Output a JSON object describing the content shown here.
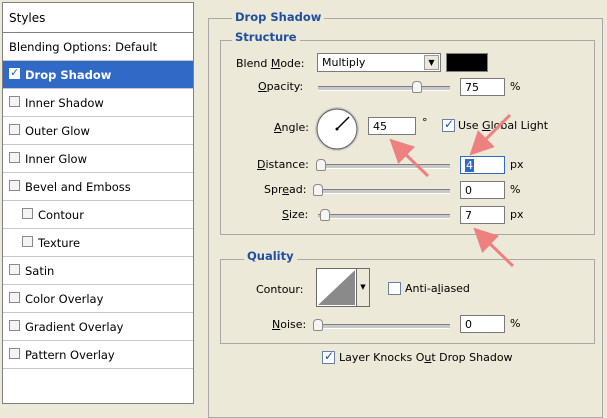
{
  "sidebar": {
    "header": "Styles",
    "items": [
      {
        "label": "Blending Options: Default",
        "checkbox": false,
        "checked": false,
        "selected": false,
        "indent": false
      },
      {
        "label": "Drop Shadow",
        "checkbox": true,
        "checked": true,
        "selected": true,
        "indent": false
      },
      {
        "label": "Inner Shadow",
        "checkbox": true,
        "checked": false,
        "selected": false,
        "indent": false
      },
      {
        "label": "Outer Glow",
        "checkbox": true,
        "checked": false,
        "selected": false,
        "indent": false
      },
      {
        "label": "Inner Glow",
        "checkbox": true,
        "checked": false,
        "selected": false,
        "indent": false
      },
      {
        "label": "Bevel and Emboss",
        "checkbox": true,
        "checked": false,
        "selected": false,
        "indent": false
      },
      {
        "label": "Contour",
        "checkbox": true,
        "checked": false,
        "selected": false,
        "indent": true
      },
      {
        "label": "Texture",
        "checkbox": true,
        "checked": false,
        "selected": false,
        "indent": true
      },
      {
        "label": "Satin",
        "checkbox": true,
        "checked": false,
        "selected": false,
        "indent": false
      },
      {
        "label": "Color Overlay",
        "checkbox": true,
        "checked": false,
        "selected": false,
        "indent": false
      },
      {
        "label": "Gradient Overlay",
        "checkbox": true,
        "checked": false,
        "selected": false,
        "indent": false
      },
      {
        "label": "Pattern Overlay",
        "checkbox": true,
        "checked": false,
        "selected": false,
        "indent": false
      }
    ]
  },
  "drop_shadow": {
    "title": "Drop Shadow",
    "structure": {
      "title": "Structure",
      "blend_mode": {
        "label_pre": "Blend ",
        "label_u": "M",
        "label_post": "ode:",
        "value": "Multiply",
        "color": "#000000"
      },
      "opacity": {
        "label_u": "O",
        "label_post": "pacity:",
        "value": "75",
        "unit": "%",
        "slider": 0.75
      },
      "angle": {
        "label_u": "A",
        "label_post": "ngle:",
        "value": "45",
        "unit": "°",
        "degrees": 45
      },
      "global_light": {
        "label_pre": "Use ",
        "label_u": "G",
        "label_post": "lobal Light",
        "checked": true
      },
      "distance": {
        "label_u": "D",
        "label_post": "istance:",
        "value": "4",
        "unit": "px",
        "slider": 0.02
      },
      "spread": {
        "label_pre": "Spr",
        "label_u": "e",
        "label_post": "ad:",
        "value": "0",
        "unit": "%",
        "slider": 0.0
      },
      "size": {
        "label_u": "S",
        "label_post": "ize:",
        "value": "7",
        "unit": "px",
        "slider": 0.05
      }
    },
    "quality": {
      "title": "Quality",
      "contour_label": "Contour:",
      "anti_aliased": {
        "label_pre": "Anti-a",
        "label_u": "l",
        "label_post": "iased",
        "checked": false
      },
      "noise": {
        "label_u": "N",
        "label_post": "oise:",
        "value": "0",
        "unit": "%",
        "slider": 0.0
      }
    },
    "knockout": {
      "label_pre": "Layer Knocks O",
      "label_u": "u",
      "label_post": "t Drop Shadow",
      "checked": true
    }
  },
  "colors": {
    "selection": "#3169c6",
    "group_title": "#1e4fa0",
    "annotation_arrow": "#ee8080"
  }
}
